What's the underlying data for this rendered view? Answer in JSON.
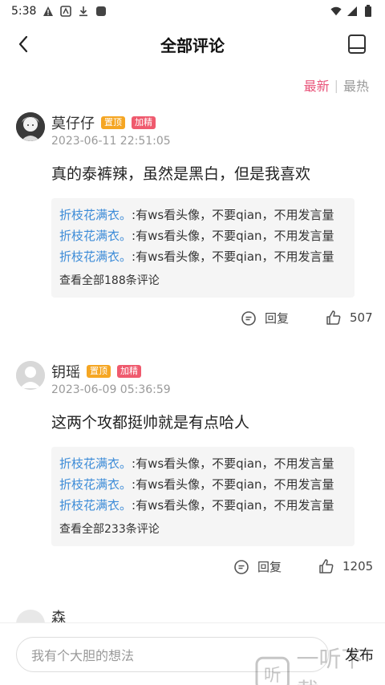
{
  "status_bar": {
    "time": "5:38"
  },
  "nav": {
    "title": "全部评论"
  },
  "sort": {
    "active": "最新",
    "separator": "|",
    "inactive": "最热"
  },
  "comments": [
    {
      "user": "莫仔仔",
      "tags": [
        "置顶",
        "加精"
      ],
      "time": "2023-06-11 22:51:05",
      "content": "真的泰裤辣，虽然是黑白，但是我喜欢",
      "replies": [
        {
          "user": "折枝花满衣。",
          "text": ":有ws看头像，不要qian，不用发言量"
        },
        {
          "user": "折枝花满衣。",
          "text": ":有ws看头像，不要qian，不用发言量"
        },
        {
          "user": "折枝花满衣。",
          "text": ":有ws看头像，不要qian，不用发言量"
        }
      ],
      "view_all": "查看全部188条评论",
      "reply_label": "回复",
      "likes": "507"
    },
    {
      "user": "钥瑶",
      "tags": [
        "置顶",
        "加精"
      ],
      "time": "2023-06-09 05:36:59",
      "content": "这两个攻都挺帅就是有点哈人",
      "replies": [
        {
          "user": "折枝花满衣。",
          "text": ":有ws看头像，不要qian，不用发言量"
        },
        {
          "user": "折枝花满衣。",
          "text": ":有ws看头像，不要qian，不用发言量"
        },
        {
          "user": "折枝花满衣。",
          "text": ":有ws看头像，不要qian，不用发言量"
        }
      ],
      "view_all": "查看全部233条评论",
      "reply_label": "回复",
      "likes": "1205"
    },
    {
      "user": "森"
    }
  ],
  "bottom": {
    "placeholder": "我有个大胆的想法",
    "send": "发布"
  },
  "watermark": {
    "text": "一听下载",
    "logo_char": "听"
  },
  "colors": {
    "accent": "#e8547a",
    "link": "#3d8cd8",
    "tag_top": "#f5a623",
    "tag_elite": "#ef5a6e"
  }
}
